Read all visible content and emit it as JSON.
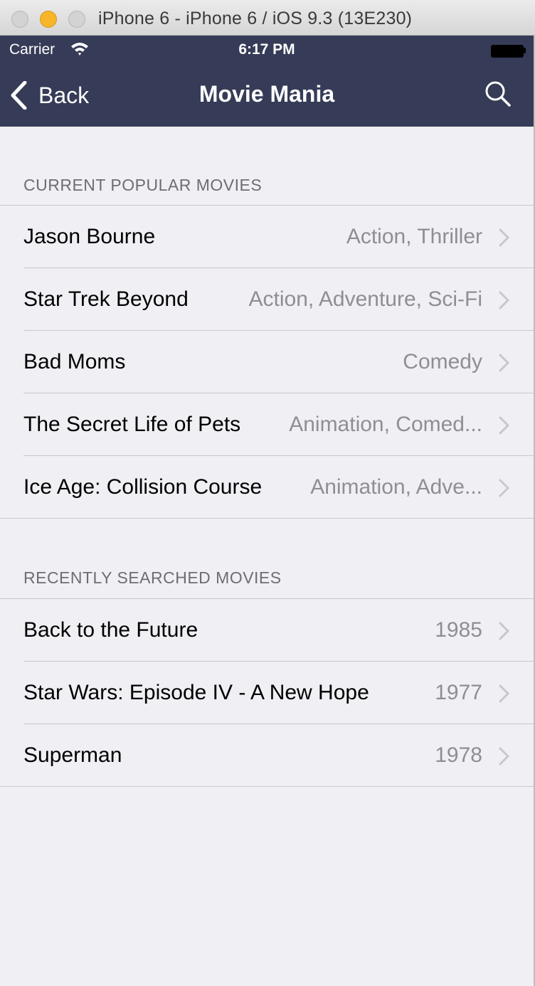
{
  "window": {
    "title": "iPhone 6 - iPhone 6 / iOS 9.3 (13E230)"
  },
  "status_bar": {
    "carrier": "Carrier",
    "time": "6:17 PM"
  },
  "nav": {
    "back_label": "Back",
    "title": "Movie Mania"
  },
  "colors": {
    "nav_background": "#363c57",
    "table_background": "#efeff4",
    "detail_text": "#8e8e93",
    "separator": "#c8c7cc"
  },
  "sections": [
    {
      "header": "CURRENT POPULAR MOVIES",
      "rows": [
        {
          "title": "Jason Bourne",
          "detail": "Action, Thriller"
        },
        {
          "title": "Star Trek Beyond",
          "detail": "Action, Adventure, Sci-Fi"
        },
        {
          "title": "Bad Moms",
          "detail": "Comedy"
        },
        {
          "title": "The Secret Life of Pets",
          "detail": "Animation, Comed..."
        },
        {
          "title": "Ice Age: Collision Course",
          "detail": "Animation, Adve..."
        }
      ]
    },
    {
      "header": "RECENTLY SEARCHED MOVIES",
      "rows": [
        {
          "title": "Back to the Future",
          "detail": "1985"
        },
        {
          "title": "Star Wars: Episode IV - A New Hope",
          "detail": "1977"
        },
        {
          "title": "Superman",
          "detail": "1978"
        }
      ]
    }
  ]
}
